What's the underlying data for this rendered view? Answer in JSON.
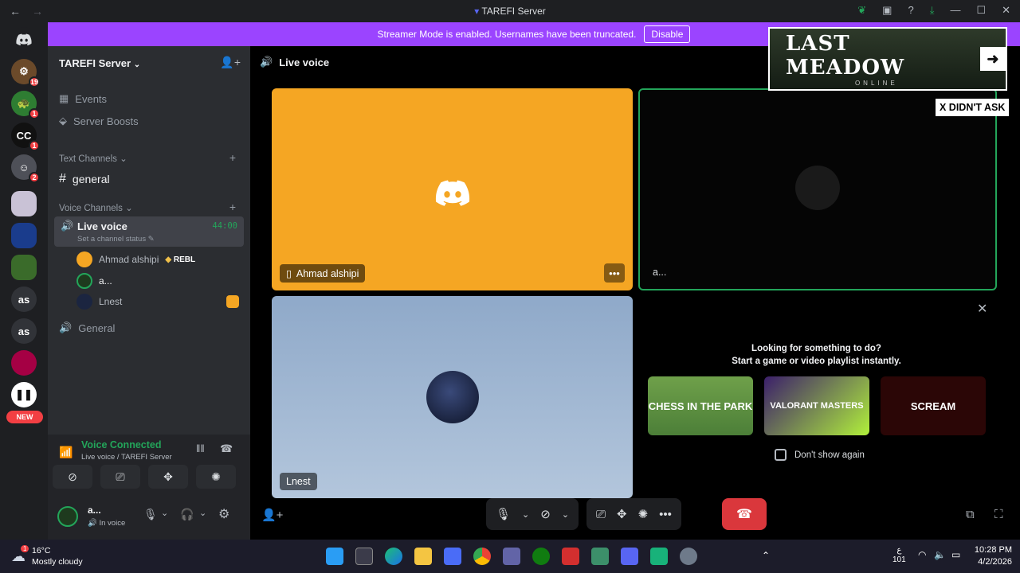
{
  "window": {
    "title": "TAREFI Server",
    "back": "←",
    "forward": "→",
    "controls": [
      "—",
      "☐",
      "✕"
    ]
  },
  "banner": {
    "text": "Streamer Mode is enabled. Usernames have been truncated.",
    "button": "Disable"
  },
  "servers": [
    {
      "label": "",
      "badge": "19"
    },
    {
      "label": "",
      "badge": "1"
    },
    {
      "label": "CC",
      "badge": "1"
    },
    {
      "label": "",
      "badge": "2"
    },
    {
      "label": "as",
      "badge": ""
    },
    {
      "label": "as",
      "badge": ""
    }
  ],
  "new_tag": "NEW",
  "sidebar": {
    "server_name": "TAREFI Server",
    "items": [
      {
        "label": "Events"
      },
      {
        "label": "Server Boosts"
      }
    ],
    "text_category": "Text Channels",
    "text_channels": [
      {
        "label": "general"
      }
    ],
    "voice_category": "Voice Channels",
    "live_voice": {
      "label": "Live voice",
      "time": "44:00",
      "status": "Set a channel status"
    },
    "members": [
      {
        "name": "Ahmad alshipi",
        "tag": "REBL"
      },
      {
        "name": "a..."
      },
      {
        "name": "Lnest"
      }
    ],
    "general_voice": "General"
  },
  "voice_panel": {
    "title": "Voice Connected",
    "subtitle": "Live voice / TAREFI Server"
  },
  "userbar": {
    "name": "a...",
    "status": "In voice"
  },
  "main": {
    "header": "Live voice",
    "tiles": [
      {
        "name": "Ahmad alshipi"
      },
      {
        "name": "a..."
      },
      {
        "name": "Lnest"
      }
    ],
    "activity": {
      "line1": "Looking for something to do?",
      "line2": "Start a game or video playlist instantly.",
      "dont_show": "Don't show again",
      "games": [
        "CHESS IN THE PARK",
        "VALORANT MASTERS",
        "SCREAM"
      ]
    }
  },
  "overlay": {
    "logo": "LAST MEADOW",
    "logo_sub": "ONLINE",
    "tag": "X DIDN'T ASK"
  },
  "taskbar": {
    "weather_temp": "16°C",
    "weather_desc": "Mostly cloudy",
    "weather_badge": "1",
    "time": "10:28 PM",
    "date": "4/2/2026",
    "lang": "ع",
    "lang_sub": "101"
  },
  "colors": {
    "accent": "#9b44ff",
    "orange_tile": "#f5a623",
    "blue_tile": "#8fa9c9",
    "green": "#23a55a",
    "red": "#da373c"
  }
}
